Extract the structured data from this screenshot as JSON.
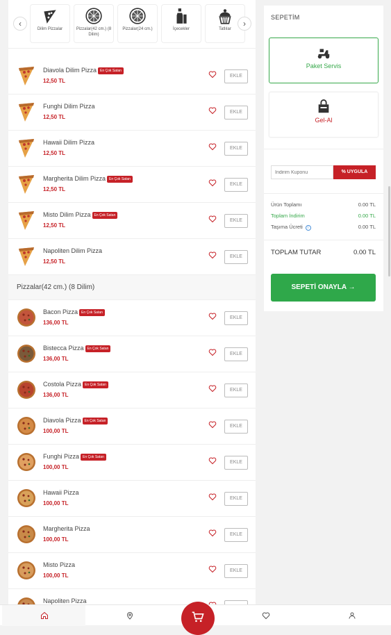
{
  "categories": [
    {
      "label": "Dilim Pizzalar",
      "icon": "pizza-slice-icon"
    },
    {
      "label": "Pizzalar(42 cm.) (8 Dilim)",
      "icon": "pizza-icon"
    },
    {
      "label": "Pizzalar(24 cm.)",
      "icon": "pizza-icon"
    },
    {
      "label": "İçecekler",
      "icon": "drink-icon"
    },
    {
      "label": "Tatlılar",
      "icon": "dessert-icon"
    }
  ],
  "slice_items": [
    {
      "name": "Diavola Dilim Pizza",
      "price": "12,50 TL",
      "badge": "En Çok Satan"
    },
    {
      "name": "Funghi Dilim Pizza",
      "price": "12,50 TL",
      "badge": ""
    },
    {
      "name": "Hawaii Dilim Pizza",
      "price": "12,50 TL",
      "badge": ""
    },
    {
      "name": "Margherita Dilim Pizza",
      "price": "12,50 TL",
      "badge": "En Çok Satan"
    },
    {
      "name": "Misto Dilim Pizza",
      "price": "12,50 TL",
      "badge": "En Çok Satan"
    },
    {
      "name": "Napoliten Dilim Pizza",
      "price": "12,50 TL",
      "badge": ""
    }
  ],
  "section_title": "Pizzalar(42 cm.) (8 Dilim)",
  "pizza_items": [
    {
      "name": "Bacon Pizza",
      "price": "136,00 TL",
      "badge": "En Çok Satan",
      "color": "#c2553c"
    },
    {
      "name": "Bistecca Pizza",
      "price": "136,00 TL",
      "badge": "En Çok Satan",
      "color": "#7a5a3a"
    },
    {
      "name": "Costola Pizza",
      "price": "136,00 TL",
      "badge": "En Çok Satan",
      "color": "#b8442e"
    },
    {
      "name": "Diavola Pizza",
      "price": "100,00 TL",
      "badge": "En Çok Satan",
      "color": "#d48a46"
    },
    {
      "name": "Funghi Pizza",
      "price": "100,00 TL",
      "badge": "En Çok Satan",
      "color": "#e0a060"
    },
    {
      "name": "Hawaii Pizza",
      "price": "100,00 TL",
      "badge": "",
      "color": "#d9a25a"
    },
    {
      "name": "Margherita Pizza",
      "price": "100,00 TL",
      "badge": "",
      "color": "#c98a48"
    },
    {
      "name": "Misto Pizza",
      "price": "100,00 TL",
      "badge": "",
      "color": "#d89c5c"
    },
    {
      "name": "Napoliten Pizza",
      "price": "",
      "badge": "",
      "color": "#c88a50"
    }
  ],
  "add_label": "EKLE",
  "cart": {
    "title": "SEPETİM",
    "delivery_label": "Paket Servis",
    "pickup_label": "Gel-Al",
    "coupon_placeholder": "İndirim Kuponu",
    "coupon_button": "% UYGULA",
    "subtotal_label": "Ürün Toplamı",
    "subtotal_value": "0.00 TL",
    "discount_label": "Toplam İndirim",
    "discount_value": "0.00 TL",
    "shipping_label": "Taşıma Ücreti",
    "shipping_value": "0.00 TL",
    "total_label": "TOPLAM TUTAR",
    "total_value": "0.00 TL",
    "confirm_label": "SEPETİ ONAYLA →"
  },
  "colors": {
    "accent": "#c62127",
    "green": "#2fa84a"
  }
}
